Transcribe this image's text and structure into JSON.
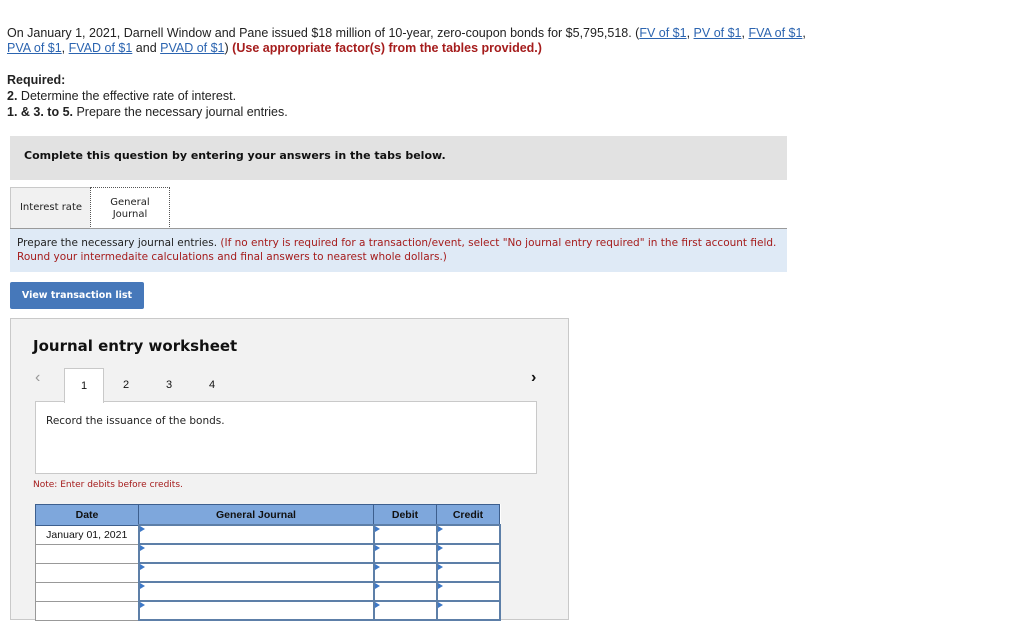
{
  "intro": {
    "text1": "On January 1, 2021, Darnell Window and Pane issued $18 million of 10-year, zero-coupon bonds for $5,795,518. (",
    "links": [
      "FV of $1",
      "PV of $1",
      "FVA of $1",
      "PVA of $1",
      "FVAD of $1",
      "PVAD of $1"
    ],
    "and": " and ",
    "close": ")",
    "instruction": "(Use appropriate factor(s) from the tables provided.)"
  },
  "required": {
    "heading": "Required:",
    "items": [
      {
        "num": "2.",
        "text": " Determine the effective rate of interest."
      },
      {
        "num": "1. & 3. to 5.",
        "text": " Prepare the necessary journal entries."
      }
    ]
  },
  "banner": "Complete this question by entering your answers in the tabs below.",
  "tabs": [
    {
      "label": "Interest rate",
      "active": false
    },
    {
      "label": "General Journal",
      "active": true
    }
  ],
  "instructions": {
    "main": "Prepare the necessary journal entries.",
    "note": "(If no entry is required for a transaction/event, select \"No journal entry required\" in the first account field. Round your intermedaite calculations and final answers to nearest whole dollars.)"
  },
  "view_button": "View transaction list",
  "worksheet": {
    "title": "Journal entry worksheet",
    "prev_icon": "chevron-left-icon",
    "next_icon": "chevron-right-icon",
    "pages": [
      "1",
      "2",
      "3",
      "4"
    ],
    "active_page": "1",
    "record_text": "Record the issuance of the bonds.",
    "note": "Note: Enter debits before credits.",
    "columns": [
      "Date",
      "General Journal",
      "Debit",
      "Credit"
    ],
    "rows": [
      {
        "date": "January 01, 2021",
        "account": "",
        "debit": "",
        "credit": ""
      },
      {
        "date": "",
        "account": "",
        "debit": "",
        "credit": ""
      },
      {
        "date": "",
        "account": "",
        "debit": "",
        "credit": ""
      },
      {
        "date": "",
        "account": "",
        "debit": "",
        "credit": ""
      },
      {
        "date": "",
        "account": "",
        "debit": "",
        "credit": ""
      }
    ]
  },
  "colors": {
    "link": "#2b64b0",
    "instruction_red": "#a51c1c",
    "button_blue": "#4678ba",
    "table_header": "#7ea7dc"
  }
}
